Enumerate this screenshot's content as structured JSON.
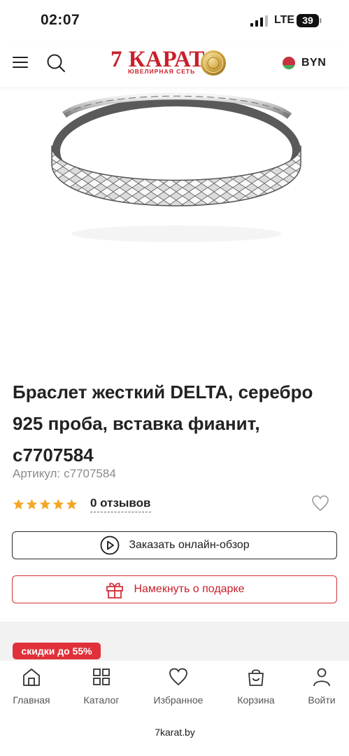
{
  "status_bar": {
    "time": "02:07",
    "network": "LTE",
    "battery": "39"
  },
  "header": {
    "logo_main": "7 КАРАТ",
    "logo_sub": "ЮВЕЛИРНАЯ СЕТЬ",
    "currency": "BYN",
    "icons": {
      "menu": "menu-icon",
      "search": "search-icon",
      "flag": "belarus-flag-icon"
    }
  },
  "product": {
    "title": "Браслет жесткий DELTA, серебро 925 проба, вставка фианит, с7707584",
    "sku_label": "Артикул:",
    "sku_value": "с7707584",
    "rating": 5,
    "star_color": "#f5a623",
    "reviews": "0 отзывов"
  },
  "actions": {
    "review_label": "Заказать онлайн-обзор",
    "hint_label": "Намекнуть о подарке",
    "accent_color": "#c8202a"
  },
  "promo": {
    "badge": "скидки до 55%"
  },
  "bottom_nav": {
    "items": [
      {
        "label": "Главная",
        "icon": "home-icon"
      },
      {
        "label": "Каталог",
        "icon": "catalog-grid-icon"
      },
      {
        "label": "Избранное",
        "icon": "heart-icon"
      },
      {
        "label": "Корзина",
        "icon": "cart-icon"
      },
      {
        "label": "Войти",
        "icon": "user-icon"
      }
    ]
  },
  "browser": {
    "url": "7karat.by"
  }
}
